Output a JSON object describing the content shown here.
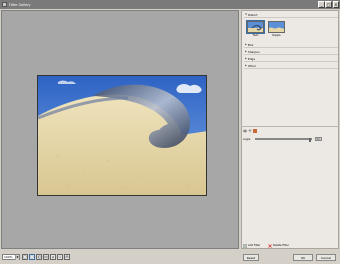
{
  "window": {
    "title": "Filter Gallery",
    "buttons": {
      "minimize": "_",
      "maximize": "□",
      "close": "×"
    }
  },
  "right_panel": {
    "category_open": "Distort",
    "thumbnails": [
      {
        "label": "Twirl",
        "selected": true
      },
      {
        "label": "Ripple",
        "selected": false
      }
    ],
    "categories_collapsed": [
      "Blur",
      "Sharpen",
      "Edge",
      "Other"
    ],
    "param": {
      "label": "Angle",
      "value": "360",
      "fraction": 1.0
    },
    "add_filter_label": "Add Filter",
    "delete_filter_label": "Delete Filter"
  },
  "bottom_bar": {
    "zoom_value": "100%",
    "reset_label": "Reset",
    "ok_label": "OK",
    "cancel_label": "Cancel"
  },
  "colors": {
    "preview_bg": "#a7a7a7",
    "panel_bg": "#ece9e4",
    "sky": "#4a86d6",
    "sand": "#e6d7a8"
  }
}
